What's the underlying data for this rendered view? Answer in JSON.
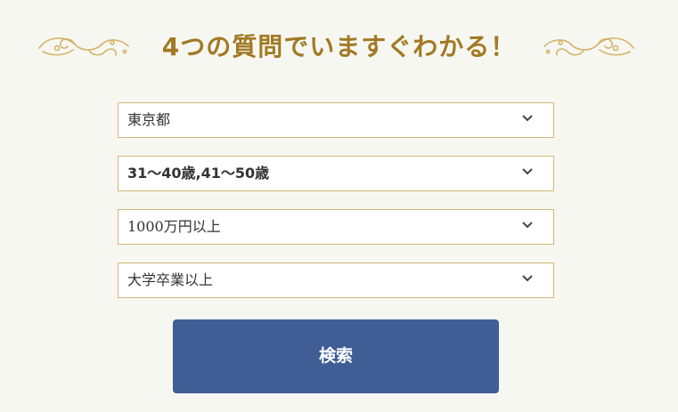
{
  "header": {
    "title": "4つの質問でいますぐわかる！"
  },
  "filters": [
    {
      "value": "東京都"
    },
    {
      "value": "31〜40歳,41〜50歳"
    },
    {
      "value": "1000万円以上"
    },
    {
      "value": "大学卒業以上"
    }
  ],
  "search_button": {
    "label": "検索"
  },
  "colors": {
    "accent_gold": "#a27a24",
    "border_gold": "#d1b87a",
    "button_blue": "#3f5e96",
    "background": "#f7f7f2"
  },
  "icons": {
    "dropdown": "chevron-down-icon",
    "ornament": "flourish-ornament-icon"
  }
}
